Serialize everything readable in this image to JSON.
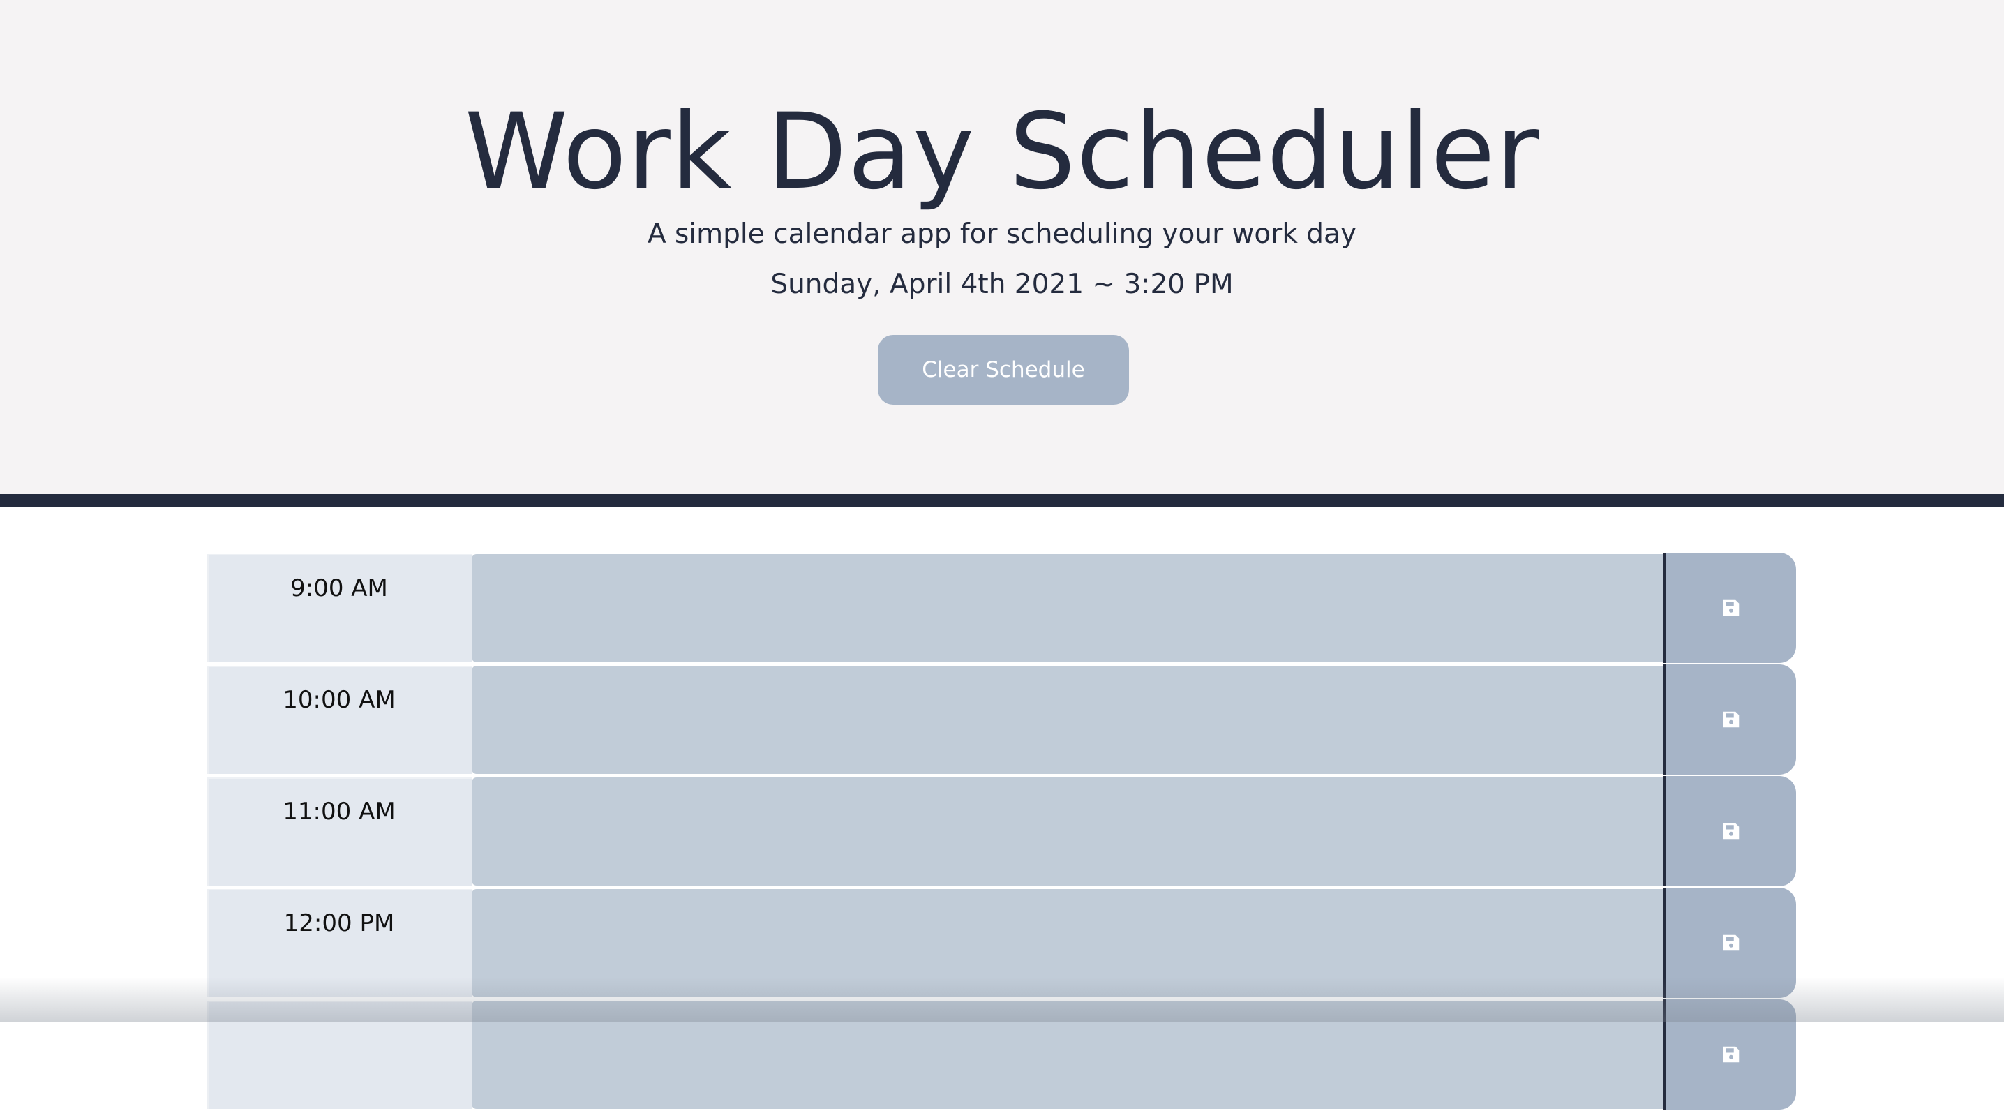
{
  "header": {
    "title": "Work Day Scheduler",
    "subtitle": "A simple calendar app for scheduling your work day",
    "datetime": "Sunday, April 4th 2021 ~ 3:20 PM",
    "clear_label": "Clear Schedule"
  },
  "rows": [
    {
      "hour": "9:00 AM",
      "task": ""
    },
    {
      "hour": "10:00 AM",
      "task": ""
    },
    {
      "hour": "11:00 AM",
      "task": ""
    },
    {
      "hour": "12:00 PM",
      "task": ""
    },
    {
      "hour": "",
      "task": ""
    }
  ],
  "icons": {
    "save": "save-icon"
  },
  "colors": {
    "header_bg": "#f5f3f4",
    "header_text": "#242b3e",
    "divider": "#242b3e",
    "button": "#a6b4c7",
    "hour_bg": "#e3e8ef",
    "task_past": "#c1ccd8"
  }
}
